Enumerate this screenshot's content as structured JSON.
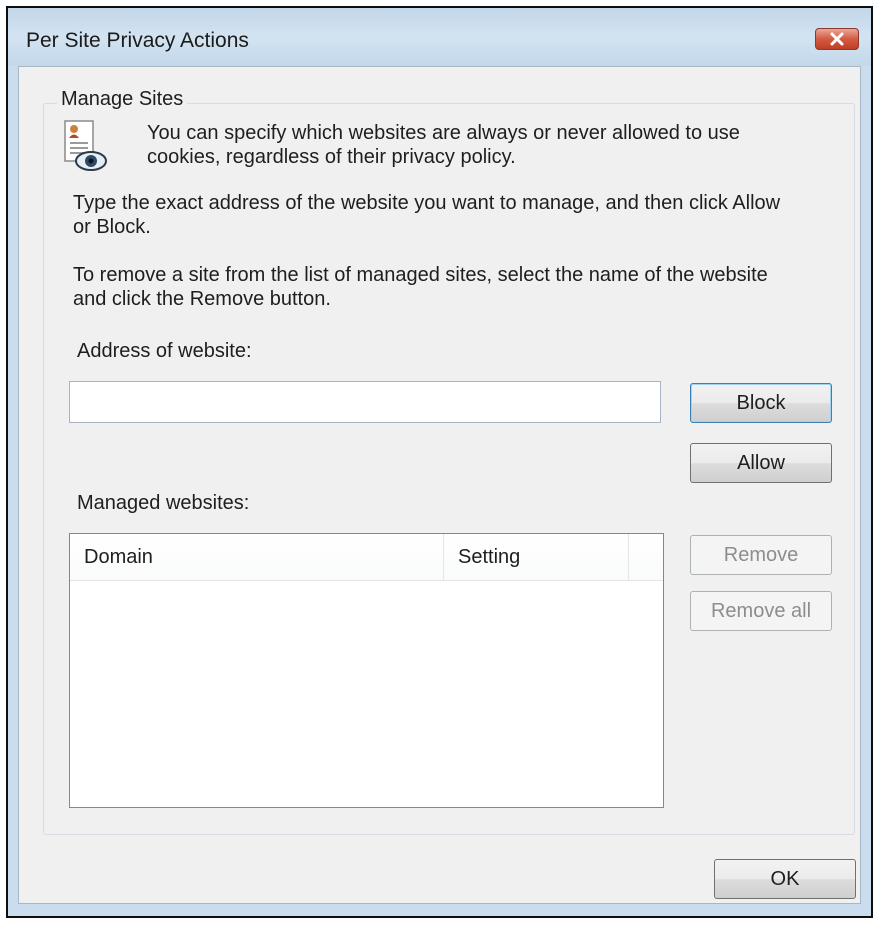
{
  "window": {
    "title": "Per Site Privacy Actions"
  },
  "manage_sites": {
    "group_label": "Manage Sites",
    "intro_line1": "You can specify which websites are always or never allowed to use",
    "intro_line2": "cookies, regardless of their privacy policy.",
    "instruction_line1": "Type the exact address of the website you want to manage, and then click Allow",
    "instruction_line2": "or Block.",
    "remove_line1": "To remove a site from the list of managed sites, select the name of the website",
    "remove_line2": "and click the Remove button.",
    "address_label": "Address of website:",
    "address_value": "",
    "block_label": "Block",
    "allow_label": "Allow",
    "managed_label": "Managed websites:",
    "columns": [
      "Domain",
      "Setting"
    ],
    "rows": [],
    "remove_label": "Remove",
    "remove_all_label": "Remove all"
  },
  "footer": {
    "ok_label": "OK"
  },
  "icons": {
    "close": "close-icon",
    "privacy": "privacy-document-icon"
  },
  "colors": {
    "close_button": "#c8452a",
    "default_button_border": "#3c7fb1"
  }
}
